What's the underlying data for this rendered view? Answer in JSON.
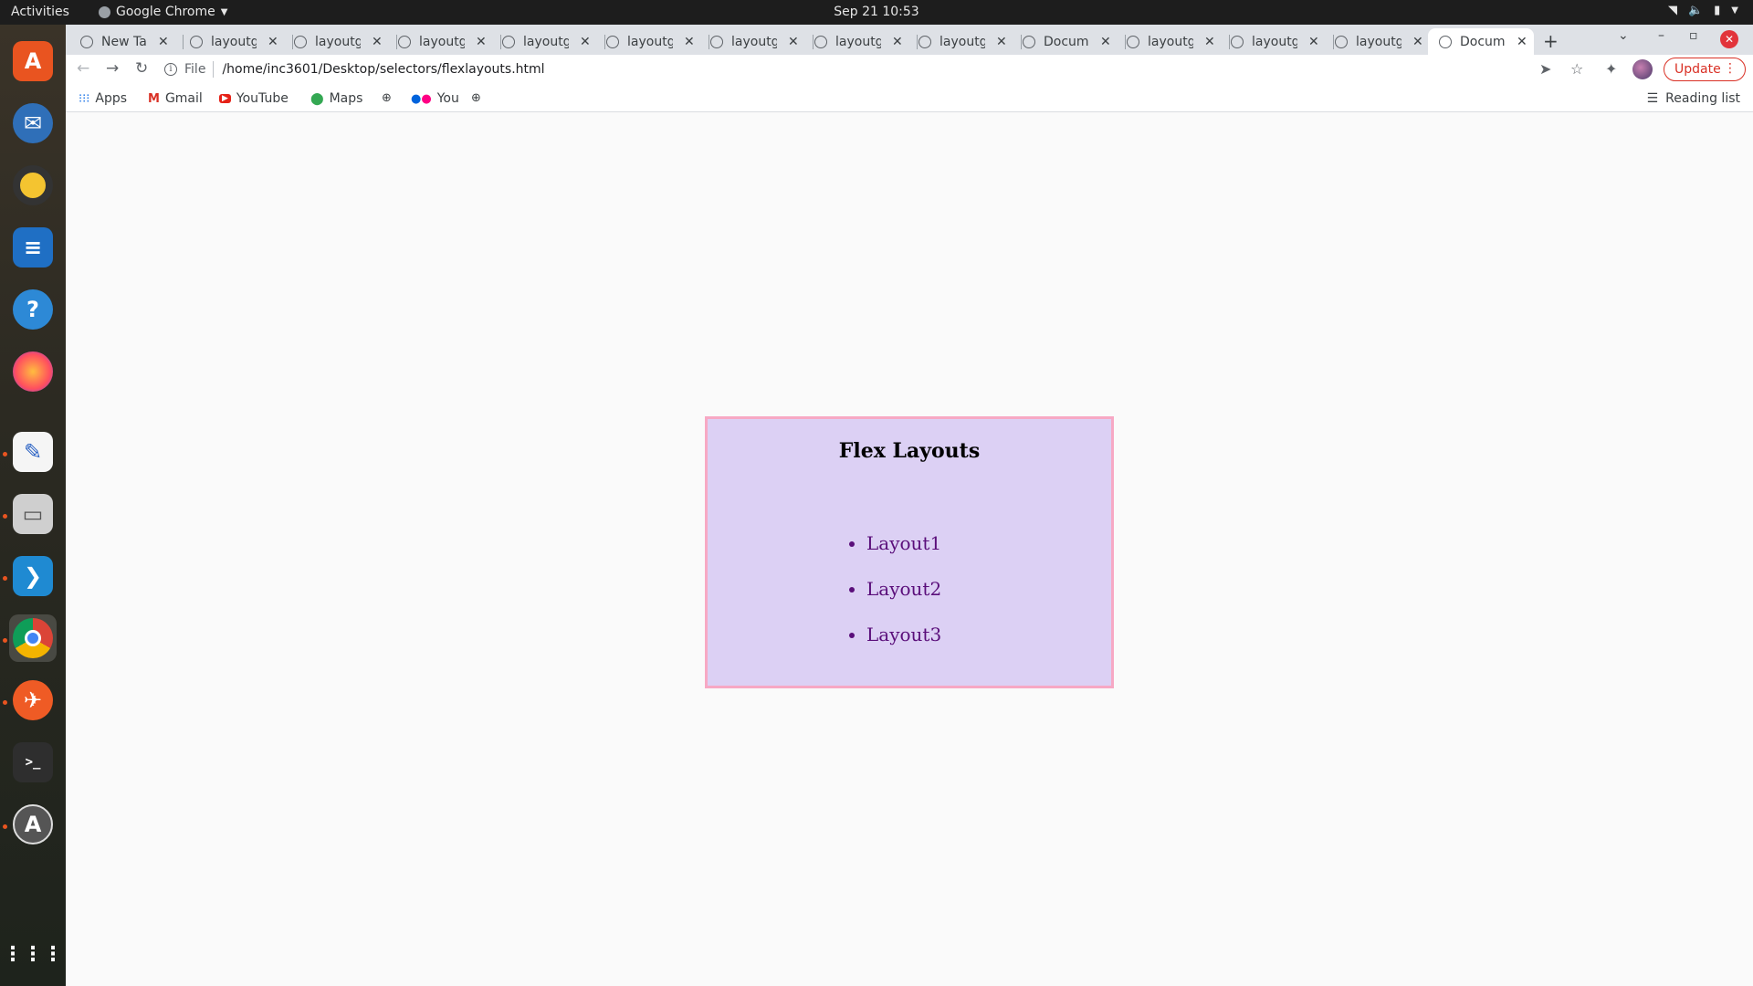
{
  "topbar": {
    "activities": "Activities",
    "app_name": "Google Chrome",
    "clock": "Sep 21  10:53"
  },
  "dock": {
    "items": [
      "software-center",
      "thunderbird",
      "rhythmbox",
      "writer",
      "help",
      "firefox",
      "text-editor",
      "files",
      "vscode",
      "chrome",
      "postman",
      "terminal",
      "software-updater",
      "app-grid"
    ]
  },
  "tabs": [
    {
      "title": "New Ta"
    },
    {
      "title": "layoutg"
    },
    {
      "title": "layoutg"
    },
    {
      "title": "layoutg"
    },
    {
      "title": "layoutg"
    },
    {
      "title": "layoutg"
    },
    {
      "title": "layoutg"
    },
    {
      "title": "layoutg"
    },
    {
      "title": "layoutg"
    },
    {
      "title": "Docum"
    },
    {
      "title": "layoutg"
    },
    {
      "title": "layoutg"
    },
    {
      "title": "layoutg"
    },
    {
      "title": "Docum",
      "active": true
    }
  ],
  "toolbar": {
    "scheme_label": "File",
    "url": "/home/inc3601/Desktop/selectors/flexlayouts.html",
    "update_label": "Update"
  },
  "bookmarks": {
    "items": [
      "Apps",
      "Gmail",
      "YouTube",
      "Maps",
      "",
      "You",
      ""
    ],
    "reading_list": "Reading list"
  },
  "page": {
    "heading": "Flex Layouts",
    "links": [
      "Layout1",
      "Layout2",
      "Layout3"
    ]
  },
  "colors": {
    "box_bg": "#dcd0f4",
    "box_border": "#f7a8c4",
    "link": "#5a0e7a"
  }
}
